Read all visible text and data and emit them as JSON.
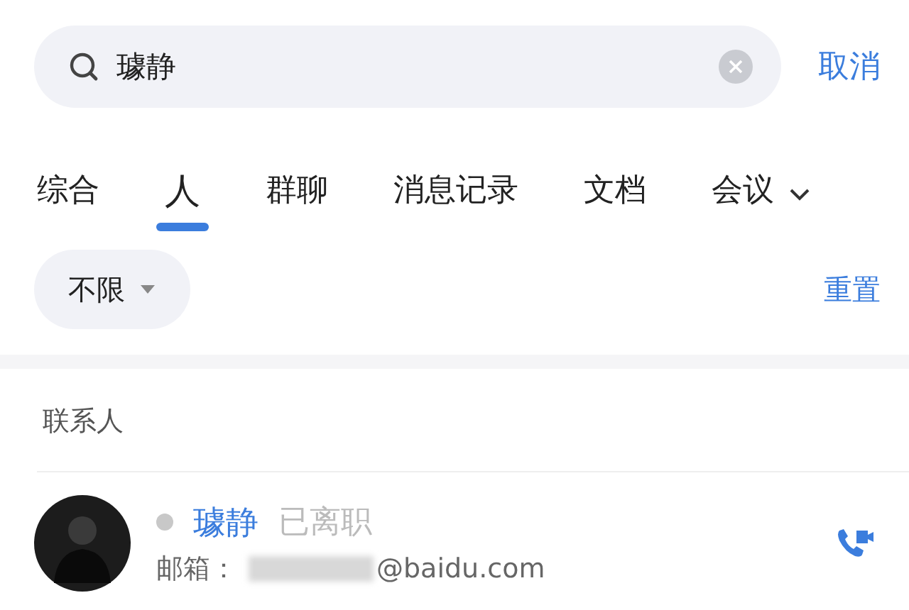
{
  "search": {
    "value": "璩静"
  },
  "cancel": "取消",
  "tabs": [
    {
      "label": "综合",
      "selected": false
    },
    {
      "label": "人",
      "selected": true
    },
    {
      "label": "群聊",
      "selected": false
    },
    {
      "label": "消息记录",
      "selected": false
    },
    {
      "label": "文档",
      "selected": false
    },
    {
      "label": "会议",
      "selected": false
    }
  ],
  "filter": {
    "label": "不限",
    "reset": "重置"
  },
  "section_title": "联系人",
  "contacts": [
    {
      "name": "璩静",
      "status": "已离职",
      "color": "#c8c8c8",
      "email_label": "邮箱：",
      "email": "@baidu.com"
    }
  ]
}
